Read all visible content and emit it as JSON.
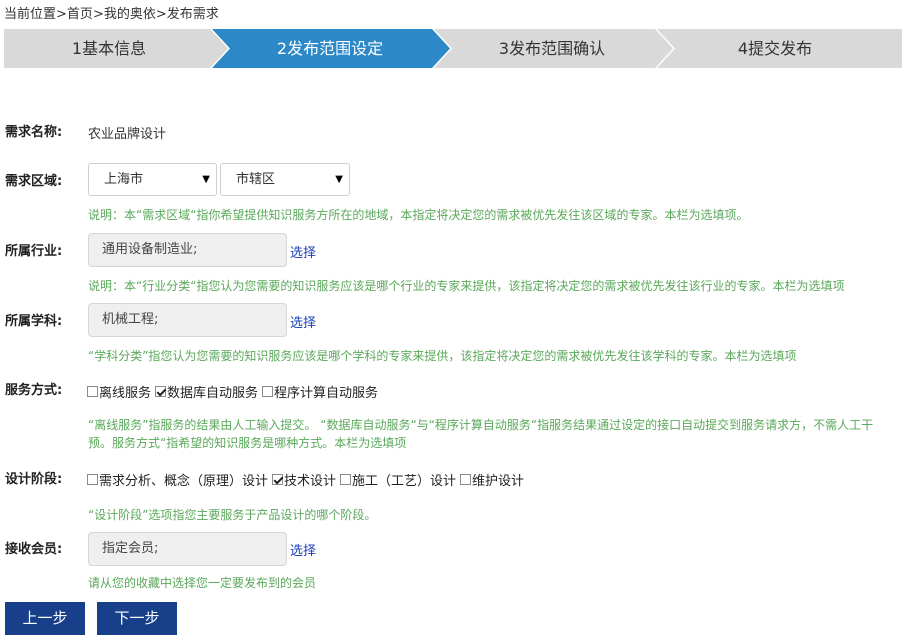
{
  "breadcrumb": {
    "prefix": "当前位置",
    "sep": ">",
    "items": [
      "首页",
      "我的奥依",
      "发布需求"
    ]
  },
  "steps": [
    {
      "label": "1基本信息",
      "active": false
    },
    {
      "label": "2发布范围设定",
      "active": true
    },
    {
      "label": "3发布范围确认",
      "active": false
    },
    {
      "label": "4提交发布",
      "active": false
    }
  ],
  "colors": {
    "step_active": "#2d88c8",
    "step_inactive": "#d9d9d9",
    "hint_text": "#5aa85a",
    "button_bg": "#173f8a",
    "link": "#1a3fb8"
  },
  "form": {
    "name": {
      "label": "需求名称:",
      "value": "农业品牌设计"
    },
    "region": {
      "label": "需求区域:",
      "province": "上海市",
      "district": "市辖区",
      "hint": "说明：本“需求区域“指你希望提供知识服务方所在的地域，本指定将决定您的需求被优先发往该区域的专家。本栏为选填项。"
    },
    "industry": {
      "label": "所属行业:",
      "value": "通用设备制造业;",
      "choose": "选择",
      "hint": "说明：本“行业分类“指您认为您需要的知识服务应该是哪个行业的专家来提供，该指定将决定您的需求被优先发往该行业的专家。本栏为选填项"
    },
    "discipline": {
      "label": "所属学科:",
      "value": "机械工程;",
      "choose": "选择",
      "hint": "“学科分类”指您认为您需要的知识服务应该是哪个学科的专家来提供，该指定将决定您的需求被优先发往该学科的专家。本栏为选填项"
    },
    "service": {
      "label": "服务方式:",
      "options": [
        {
          "label": "离线服务",
          "checked": false
        },
        {
          "label": "数据库自动服务",
          "checked": true
        },
        {
          "label": "程序计算自动服务",
          "checked": false
        }
      ],
      "hint": "“离线服务”指服务的结果由人工输入提交。 “数据库自动服务“与“程序计算自动服务“指服务结果通过设定的接口自动提交到服务请求方，不需人工干预。服务方式“指希望的知识服务是哪种方式。本栏为选填项"
    },
    "stage": {
      "label": "设计阶段:",
      "options": [
        {
          "label": "需求分析、概念（原理）设计",
          "checked": false
        },
        {
          "label": "技术设计",
          "checked": true
        },
        {
          "label": "施工（工艺）设计",
          "checked": false
        },
        {
          "label": "维护设计",
          "checked": false
        }
      ],
      "hint": "“设计阶段”选项指您主要服务于产品设计的哪个阶段。"
    },
    "member": {
      "label": "接收会员:",
      "value": "指定会员;",
      "choose": "选择",
      "hint": "请从您的收藏中选择您一定要发布到的会员"
    }
  },
  "buttons": {
    "prev": "上一步",
    "next": "下一步"
  }
}
